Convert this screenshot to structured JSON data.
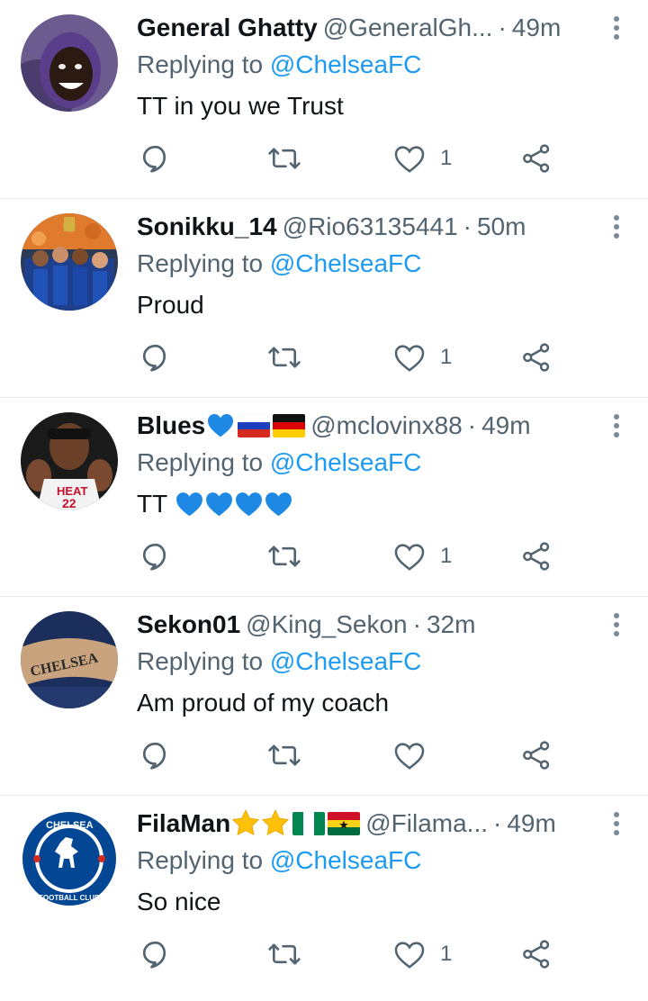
{
  "tweets": [
    {
      "name": "General Ghatty",
      "handle": "@GeneralGh...",
      "separator": "·",
      "time": "49m",
      "replying_prefix": "Replying to ",
      "replying_to": "@ChelseaFC",
      "text": "TT in you we Trust",
      "likes": "1",
      "avatar_icon": "profile-photo"
    },
    {
      "name": "Sonikku_14",
      "handle": "@Rio63135441",
      "separator": "·",
      "time": "50m",
      "replying_prefix": "Replying to ",
      "replying_to": "@ChelseaFC",
      "text": "Proud",
      "likes": "1",
      "avatar_icon": "team-celebration-photo"
    },
    {
      "name": "Blues",
      "handle": "@mclovinx88",
      "separator": "·",
      "time": "49m",
      "replying_prefix": "Replying to ",
      "replying_to": "@ChelseaFC",
      "text": "TT",
      "likes": "1",
      "avatar_icon": "basketball-player-photo"
    },
    {
      "name": "Sekon01",
      "handle": "@King_Sekon",
      "separator": "·",
      "time": "32m",
      "replying_prefix": "Replying to ",
      "replying_to": "@ChelseaFC",
      "text": "Am proud of my coach",
      "likes": "",
      "avatar_icon": "chelsea-tattoo-photo"
    },
    {
      "name": "FilaMan",
      "handle": "@Filama...",
      "separator": "·",
      "time": "49m",
      "replying_prefix": "Replying to ",
      "replying_to": "@ChelseaFC",
      "text": "So nice",
      "likes": "1",
      "avatar_icon": "chelsea-crest"
    }
  ],
  "avatar_text": {
    "crest_top": "CHELSEA",
    "crest_bottom": "FOOTBALL CLUB",
    "tattoo": "CHELSEA",
    "jersey_team": "HEAT",
    "jersey_number": "22"
  },
  "colors": {
    "link": "#1d9bf0",
    "secondary_text": "#536471",
    "divider": "#e6e9ec"
  }
}
